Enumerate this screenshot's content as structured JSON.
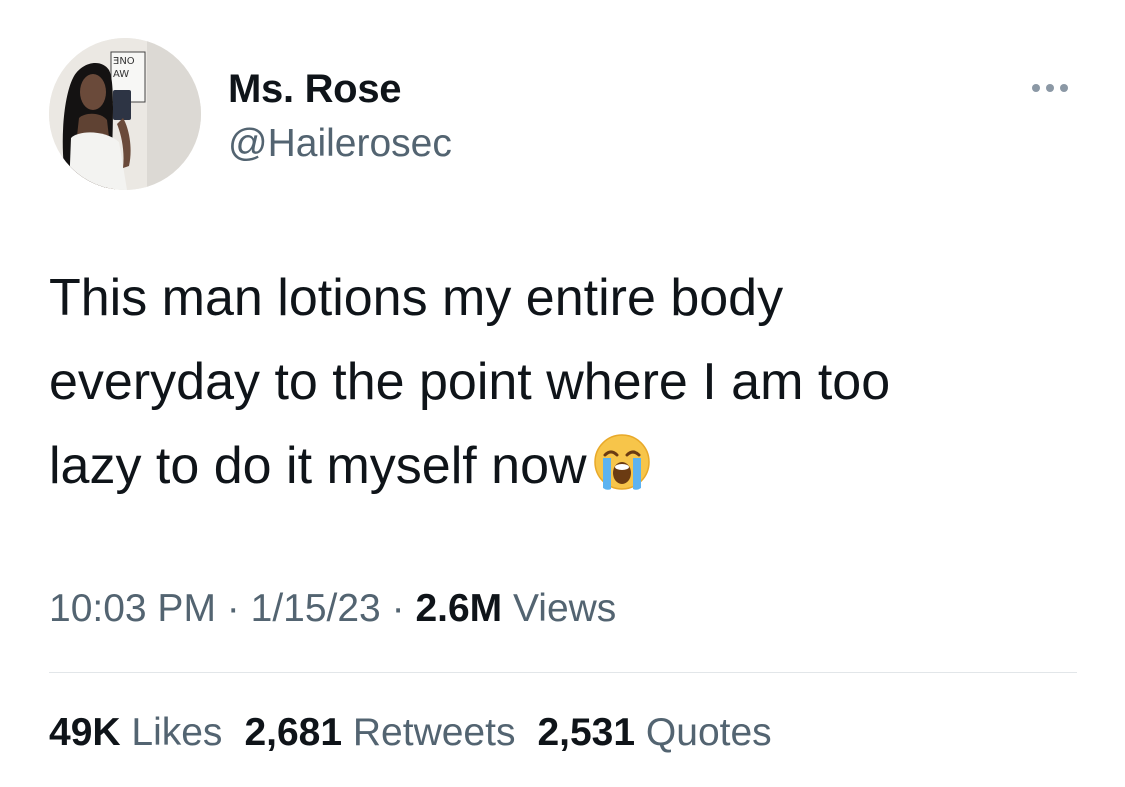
{
  "author": {
    "display_name": "Ms. Rose",
    "handle": "@Hailerosec",
    "avatar_sign_text": "ONE WAW"
  },
  "tweet": {
    "text": "This man lotions my entire body\neveryday to the point where I am too\nlazy to do it myself now",
    "emoji": "loudly-crying-face"
  },
  "meta": {
    "time": "10:03 PM",
    "separator": "·",
    "date": "1/15/23",
    "views_count": "2.6M",
    "views_label": "Views"
  },
  "stats": {
    "likes_count": "49K",
    "likes_label": "Likes",
    "retweets_count": "2,681",
    "retweets_label": "Retweets",
    "quotes_count": "2,531",
    "quotes_label": "Quotes"
  },
  "icons": {
    "more": "more-horizontal-icon"
  },
  "colors": {
    "text": "#0f1419",
    "secondary": "#536471",
    "divider": "#e2e6e9",
    "more_icon": "#8b98a5"
  }
}
